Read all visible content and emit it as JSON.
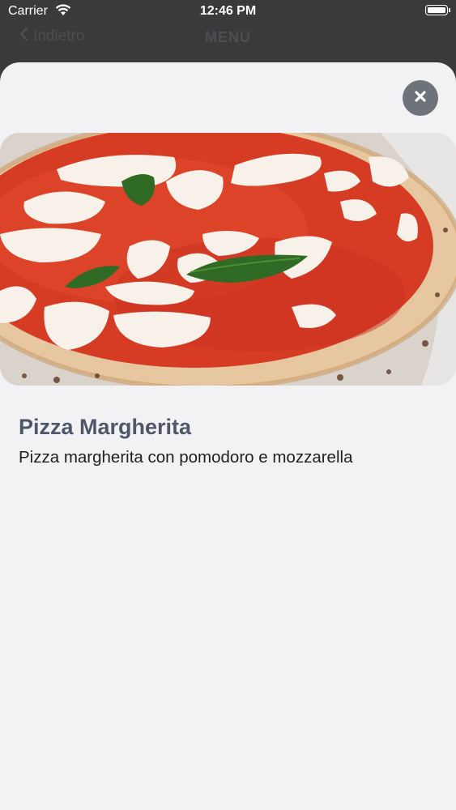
{
  "status_bar": {
    "carrier": "Carrier",
    "time": "12:46 PM"
  },
  "nav": {
    "back_label": "Indietro",
    "title": "MENU"
  },
  "sheet": {
    "close_icon": "close-icon"
  },
  "item": {
    "image_description": "pizza-margherita-photo",
    "title": "Pizza Margherita",
    "description": "Pizza margherita con pomodoro e mozzarella"
  },
  "colors": {
    "title": "#4f586a",
    "close_button": "#6e7279",
    "sheet_background": "#f2f2f4"
  }
}
